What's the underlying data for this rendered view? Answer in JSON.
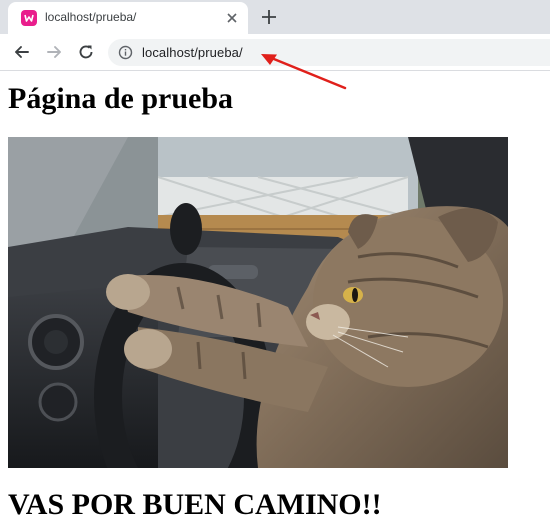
{
  "browser": {
    "tab_title": "localhost/prueba/",
    "address": "localhost/prueba/",
    "favicon": "wamp-favicon-icon"
  },
  "icons": {
    "tab_close": "close-icon",
    "new_tab": "plus-icon",
    "back": "arrow-left-icon",
    "forward": "arrow-right-icon",
    "reload": "reload-icon",
    "site_info": "info-icon"
  },
  "colors": {
    "favicon": "#e91e8c",
    "annotation_arrow": "#e0201b"
  },
  "page": {
    "heading": "Página de prueba",
    "image": "cat-driving-car-photo",
    "message": "VAS POR BUEN CAMINO!!"
  }
}
